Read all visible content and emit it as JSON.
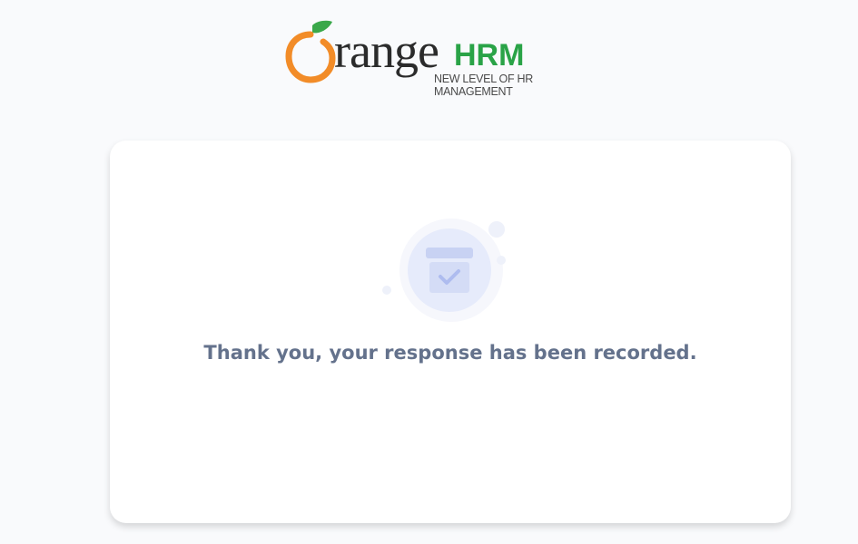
{
  "brand": {
    "wordmark": "range",
    "wordmark_suffix": "HRM",
    "tagline": "NEW LEVEL OF HR MANAGEMENT",
    "colors": {
      "orange": "#f28c28",
      "green": "#2aa347",
      "dark": "#2b2b2b"
    }
  },
  "card": {
    "icon": "calendar-check-icon",
    "message": "Thank you, your response has been recorded."
  }
}
